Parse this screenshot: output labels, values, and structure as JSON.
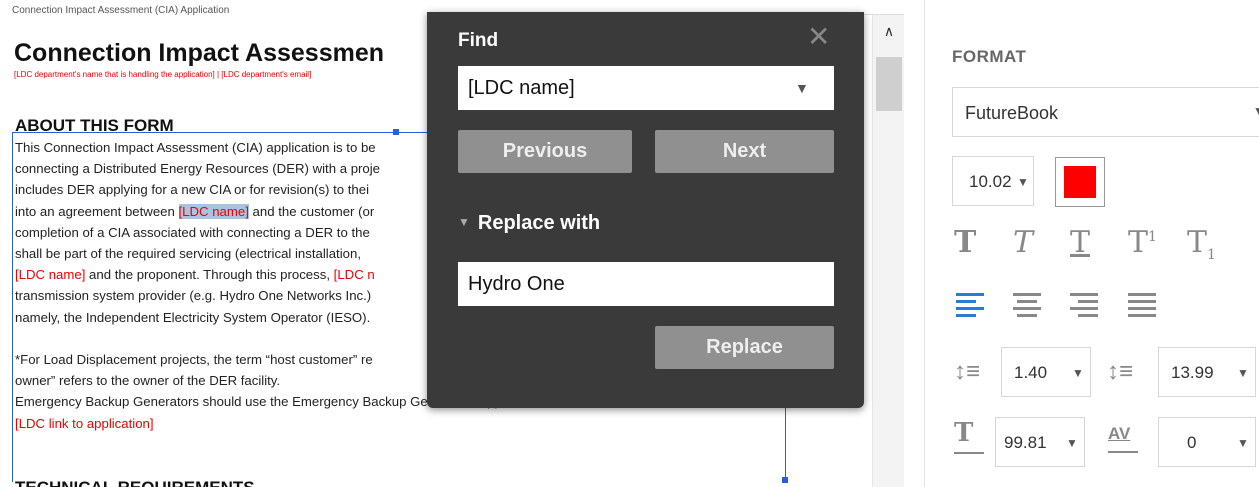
{
  "document": {
    "header": "Connection Impact Assessment (CIA) Application",
    "title": "Connection Impact Assessmen",
    "subtitle": "[LDC department's name that is handling the application] | [LDC department's email]",
    "section_heading": "ABOUT THIS FORM",
    "lines": [
      {
        "parts": [
          {
            "t": "This Connection Impact Assessment (CIA) application is to be",
            "c": "n"
          }
        ]
      },
      {
        "parts": [
          {
            "t": "connecting a Distributed Energy Resources (DER) with a proje",
            "c": "n"
          }
        ]
      },
      {
        "parts": [
          {
            "t": "includes DER applying for a new CIA or for revision(s) to thei",
            "c": "n"
          }
        ]
      },
      {
        "parts": [
          {
            "t": "into an agreement between ",
            "c": "n"
          },
          {
            "t": "[LDC name]",
            "c": "h"
          },
          {
            "t": " and the customer (or",
            "c": "n"
          }
        ]
      },
      {
        "parts": [
          {
            "t": "completion of a CIA associated with connecting a DER to the",
            "c": "n"
          }
        ]
      },
      {
        "parts": [
          {
            "t": "shall be part of the required servicing (electrical installation,",
            "c": "n"
          }
        ]
      },
      {
        "parts": [
          {
            "t": "[LDC name]",
            "c": "r"
          },
          {
            "t": " and the proponent. Through this process, ",
            "c": "n"
          },
          {
            "t": "[LDC n",
            "c": "r"
          }
        ]
      },
      {
        "parts": [
          {
            "t": "transmission system provider (e.g. Hydro One Networks Inc.)",
            "c": "n"
          }
        ]
      },
      {
        "parts": [
          {
            "t": "namely, the Independent Electricity System Operator (IESO).",
            "c": "n"
          }
        ]
      },
      {
        "parts": [
          {
            "t": "",
            "c": "n"
          }
        ]
      },
      {
        "parts": [
          {
            "t": "*For Load Displacement projects, the term “host customer” re",
            "c": "n"
          }
        ]
      },
      {
        "parts": [
          {
            "t": "owner” refers to the owner of the DER facility.",
            "c": "n"
          }
        ]
      },
      {
        "parts": [
          {
            "t": "Emergency Backup Generators should use the Emergency Backup Generation Application Form available at:",
            "c": "n"
          }
        ]
      },
      {
        "parts": [
          {
            "t": "[LDC link to application]",
            "c": "r"
          }
        ]
      }
    ],
    "bottom_heading": "TECHNICAL REQUIREMENTS"
  },
  "find_dialog": {
    "title": "Find",
    "find_value": "[LDC name]",
    "previous_label": "Previous",
    "next_label": "Next",
    "replace_with_label": "Replace with",
    "replace_value": "Hydro One",
    "replace_label": "Replace"
  },
  "format_panel": {
    "title": "FORMAT",
    "font_family": "FutureBook",
    "font_size": "10.02",
    "text_color": "#ff0000",
    "line_spacing": "1.40",
    "paragraph_spacing": "13.99",
    "char_scale": "99.81",
    "char_spacing": "0",
    "scale_label": "T",
    "spacing_label": "AV"
  }
}
